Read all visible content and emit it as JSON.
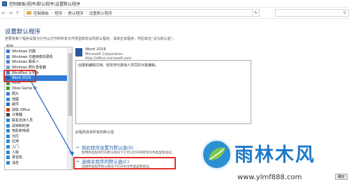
{
  "window": {
    "title": "控制面板\\程序\\默认程序\\设置默认程序"
  },
  "address_bar": {
    "path": [
      "控制面板",
      "程序",
      "默认程序",
      "设置默认程序"
    ]
  },
  "page": {
    "title": "设置默认程序",
    "description": "若要将某个程序设置为它可以打开的所有文件类型和协议的默认程序，请单击该程序，然后单击“设为默认值”。"
  },
  "program_list": {
    "label": "程序",
    "items": [
      {
        "label": "Windows 扫描",
        "color": "#3a7bd5"
      },
      {
        "label": "Windows 光盘映像刻录机",
        "color": "#5a8fd6"
      },
      {
        "label": "Windows 联系人",
        "color": "#4b86c8"
      },
      {
        "label": "Windows 照片查看器",
        "color": "#6aa0d8"
      },
      {
        "label": "WordPad 写字板",
        "color": "#4d7fbf"
      },
      {
        "label": "Word 2016",
        "color": "#2b579a",
        "selected": true
      },
      {
        "label": "Xbox",
        "color": "#3d9b35"
      },
      {
        "label": "Xbox Game UI",
        "color": "#3d9b35"
      },
      {
        "label": "照片",
        "color": "#3a7bd5"
      },
      {
        "label": "地图",
        "color": "#2b88d8"
      },
      {
        "label": "邮件",
        "color": "#2b6cc4"
      },
      {
        "label": "获取 Office",
        "color": "#d83b01"
      },
      {
        "label": "计算器",
        "color": "#444"
      },
      {
        "label": "联系支持人员",
        "color": "#2b88d8"
      },
      {
        "label": "闹钟和时钟",
        "color": "#2b88d8"
      },
      {
        "label": "电影和电视",
        "color": "#2b88d8"
      },
      {
        "label": "日历",
        "color": "#2b88d8"
      },
      {
        "label": "应用",
        "color": "#2b88d8"
      },
      {
        "label": "入门",
        "color": "#2b88d8"
      },
      {
        "label": "人脉",
        "color": "#2b88d8"
      },
      {
        "label": "录音机",
        "color": "#2b88d8"
      },
      {
        "label": "消息",
        "color": "#2b88d8"
      }
    ]
  },
  "program_info": {
    "name": "Word 2016",
    "company": "Microsoft Corporation",
    "url": "http://office.microsoft.com",
    "description": "创建和编辑文档。轻松地与其他人共同并对其编辑。"
  },
  "default_note": "此程序具有所有的默认值",
  "options": {
    "set_default": {
      "title": "将此程序设置为默认值(S)",
      "desc": "使用所选程序打开默认情况下它可以打开的所有文件类型和协议。"
    },
    "choose_defaults": {
      "title": "选择此程序的默认值(C)",
      "desc": "选择所选程序默认情况下打开的文件类型和协议。"
    }
  },
  "buttons": {
    "ok": "确定"
  },
  "watermark": {
    "brand": "雨林木风",
    "url": "www.ylmf888.com"
  }
}
